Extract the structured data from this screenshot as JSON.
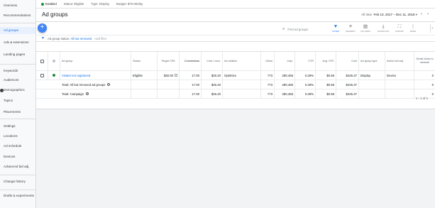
{
  "topbar": {
    "status_label": "Enabled",
    "items": [
      "Status: Eligible",
      "Type: Display",
      "Budget: $70.00/day"
    ]
  },
  "sidebar": {
    "items": [
      "Overview",
      "Recommendations",
      "Ad groups",
      "Ads & extensions",
      "Landing pages",
      "Keywords",
      "Audiences",
      "Demographics",
      "Topics",
      "Placements",
      "Settings",
      "Locations",
      "Ad schedule",
      "Devices",
      "Advanced bid adj.",
      "Change history",
      "Drafts & experiments"
    ]
  },
  "header": {
    "title": "Ad groups",
    "date_prefix": "All time",
    "date_range": "Feb 13, 2017 – Dec 11, 2018"
  },
  "toolbar": {
    "add_label": "+",
    "search_placeholder": "Find ad groups",
    "tools": [
      {
        "icon": "filter-icon",
        "label": "FILTER",
        "glyph": "▼"
      },
      {
        "icon": "segment-icon",
        "label": "SEGMENT",
        "glyph": "≡"
      },
      {
        "icon": "columns-icon",
        "label": "COLUMNS",
        "glyph": "▥"
      },
      {
        "icon": "download-icon",
        "label": "DOWNLOAD",
        "glyph": "⤓"
      },
      {
        "icon": "expand-icon",
        "label": "EXPAND",
        "glyph": "⛶"
      },
      {
        "icon": "more-icon",
        "label": "MORE",
        "glyph": "⋮"
      }
    ]
  },
  "filter": {
    "label": "Ad group status:",
    "value": "All but removed",
    "add": "Add filter"
  },
  "table": {
    "headers": [
      "Ad group",
      "Status",
      "Target CPA",
      "Conversions",
      "Cost / conv.",
      "Ad rotation",
      "Clicks",
      "Impr.",
      "CTR",
      "Avg. CPC",
      "Cost",
      "Ad group type",
      "Active bid adj.",
      "Gmail clicks to website"
    ],
    "rows": [
      [
        "Visited not registered",
        "Eligible",
        "$30.00",
        "17.00",
        "$26.20",
        "Optimize",
        "773",
        "280,465",
        "0.28%",
        "$0.58",
        "$445.37",
        "Display",
        "Device",
        "0"
      ]
    ],
    "totals": [
      {
        "label": "Total: All but removed ad groups",
        "values": [
          "17.00",
          "$26.20",
          "773",
          "280,465",
          "0.28%",
          "$0.58",
          "$445.37",
          "0"
        ]
      },
      {
        "label": "Total: Campaign",
        "values": [
          "17.00",
          "$26.20",
          "773",
          "280,465",
          "0.28%",
          "$0.58",
          "$445.37",
          "0"
        ]
      }
    ]
  },
  "pager": "1 - 1 of 1",
  "colors": {
    "accent": "#1a73e8",
    "fab": "#4285f4",
    "enabled": "#1e8e3e"
  }
}
